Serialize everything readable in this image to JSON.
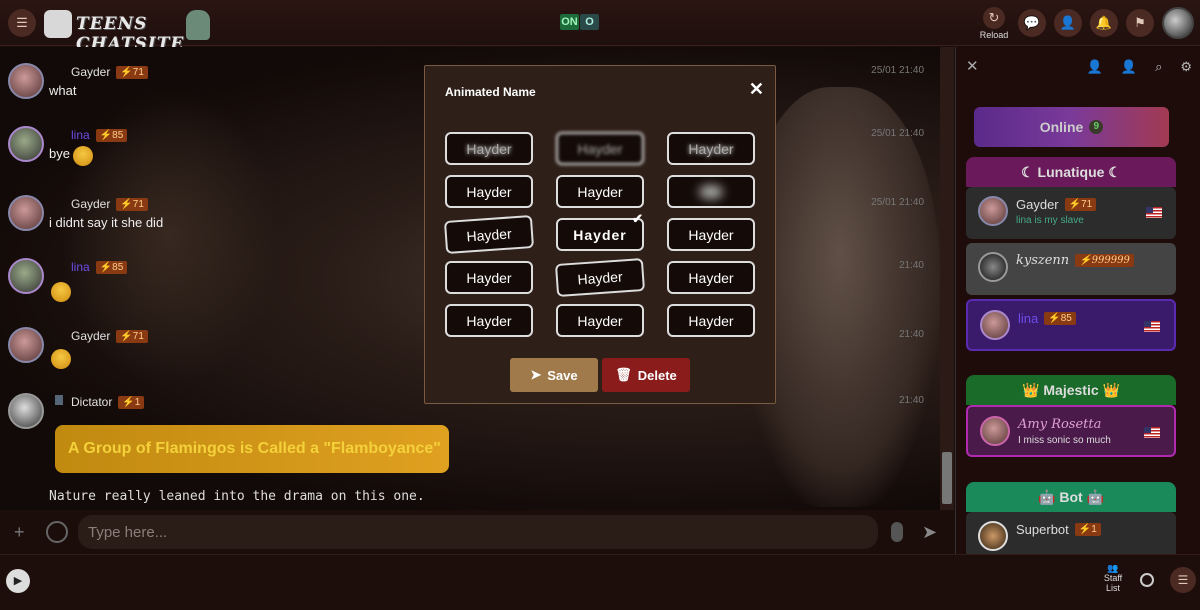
{
  "topbar": {
    "logo_text": "TEENS CHATSITE",
    "on_label": "ON",
    "off_label": "O",
    "reload_label": "Reload"
  },
  "messages": [
    {
      "user": "Gayder",
      "rank": "⚡71",
      "text": "what",
      "time": "25/01 21:40",
      "kind": "text"
    },
    {
      "user": "lina",
      "rank": "⚡85",
      "text": "bye",
      "time": "25/01 21:40",
      "kind": "emoji"
    },
    {
      "user": "Gayder",
      "rank": "⚡71",
      "text": "i didnt say it she did",
      "time": "25/01 21:40",
      "kind": "text"
    },
    {
      "user": "lina",
      "rank": "⚡85",
      "text": "",
      "time": "21:40",
      "kind": "emoji"
    },
    {
      "user": "Gayder",
      "rank": "⚡71",
      "text": "",
      "time": "21:40",
      "kind": "emoji"
    },
    {
      "user": "Dictator",
      "rank": "⚡1",
      "headline": "A Group of Flamingos is Called a \"Flamboyance\"",
      "text": "Nature really leaned into the drama on this one.",
      "time": "21:40",
      "kind": "bot"
    }
  ],
  "input": {
    "placeholder": "Type here..."
  },
  "bottombar": {
    "staff_label": "Staff List"
  },
  "sidebar": {
    "online_label": "Online",
    "online_count": "9",
    "groups": [
      {
        "title": "☾ Lunatique ☾",
        "users": [
          {
            "name": "Gayder",
            "rank": "⚡71",
            "sub": "lina is my slave"
          },
          {
            "name": "kyszenn",
            "rank": "⚡999999",
            "sub": ""
          },
          {
            "name": "lina",
            "rank": "⚡85",
            "sub": ""
          }
        ]
      },
      {
        "title": "👑 Majestic 👑",
        "users": [
          {
            "name": "Amy Rosetta",
            "rank": "",
            "sub": "I miss sonic so much"
          }
        ]
      },
      {
        "title": "🤖 Bot 🤖",
        "users": [
          {
            "name": "Superbot",
            "rank": "⚡1",
            "sub": ""
          }
        ]
      }
    ]
  },
  "modal": {
    "title": "Animated Name",
    "name_options": [
      "Hayder",
      "Hayder",
      "Hayder",
      "Hayder",
      "Hayder",
      "",
      "Hayder",
      "Hayder",
      "Hayder",
      "Hayder",
      "Hayder",
      "Hayder",
      "Hayder",
      "Hayder",
      "Hayder"
    ],
    "selected_index": 7,
    "save_label": "Save",
    "delete_label": "Delete"
  },
  "colors": {
    "save": "#a07a4a",
    "delete": "#8a1c1c",
    "rank_bg": "#8a3a12"
  }
}
